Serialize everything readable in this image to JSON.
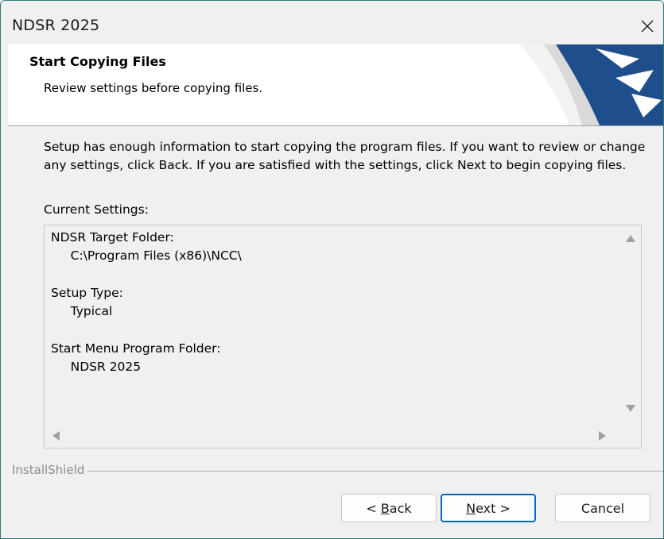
{
  "window": {
    "title": "NDSR 2025"
  },
  "banner": {
    "title": "Start Copying Files",
    "subtitle": "Review settings before copying files."
  },
  "content": {
    "description": "Setup has enough information to start copying the program files.  If you want to review or change any settings, click Back.  If you are satisfied with the settings, click Next to begin copying files.",
    "current_settings_label": "Current Settings:",
    "settings_text": "NDSR Target Folder:\n     C:\\Program Files (x86)\\NCC\\\n\nSetup Type:\n     Typical\n\nStart Menu Program Folder:\n     NDSR 2025"
  },
  "footer": {
    "brand": "InstallShield"
  },
  "buttons": {
    "back": {
      "prefix": "< ",
      "mnemonic": "B",
      "rest": "ack"
    },
    "next": {
      "mnemonic": "N",
      "rest": "ext >"
    },
    "cancel": "Cancel"
  },
  "colors": {
    "accent": "#0067c0",
    "banner_graphic": "#1f4e8c"
  },
  "icons": {
    "close": "close-icon",
    "scroll_up": "scroll-up-arrow-icon",
    "scroll_down": "scroll-down-arrow-icon",
    "scroll_left": "scroll-left-arrow-icon",
    "scroll_right": "scroll-right-arrow-icon"
  }
}
